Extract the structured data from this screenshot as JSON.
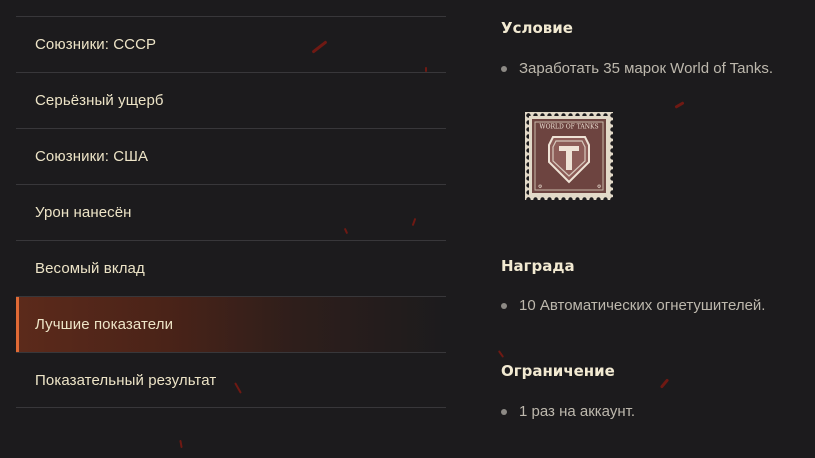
{
  "menu": {
    "items": [
      {
        "label": "Союзники: СССР",
        "active": false
      },
      {
        "label": "Серьёзный ущерб",
        "active": false
      },
      {
        "label": "Союзники: США",
        "active": false
      },
      {
        "label": "Урон нанесён",
        "active": false
      },
      {
        "label": "Весомый вклад",
        "active": false
      },
      {
        "label": "Лучшие показатели",
        "active": true
      },
      {
        "label": "Показательный результат",
        "active": false
      }
    ]
  },
  "condition": {
    "title": "Условие",
    "items": [
      "Заработать 35 марок World of Tanks."
    ]
  },
  "stamp": {
    "text": "WORLD OF TANKS",
    "icon": "world-of-tanks-stamp-icon"
  },
  "reward": {
    "title": "Награда",
    "items": [
      "10 Автоматических огнетушителей."
    ]
  },
  "limit": {
    "title": "Ограничение",
    "items": [
      "1 раз на аккаунт."
    ]
  },
  "colors": {
    "background": "#1c1b1d",
    "menu_text": "#ede4c7",
    "active_accent": "#e06a35",
    "title_text": "#f2ead2",
    "body_text": "#bdb8ad"
  }
}
